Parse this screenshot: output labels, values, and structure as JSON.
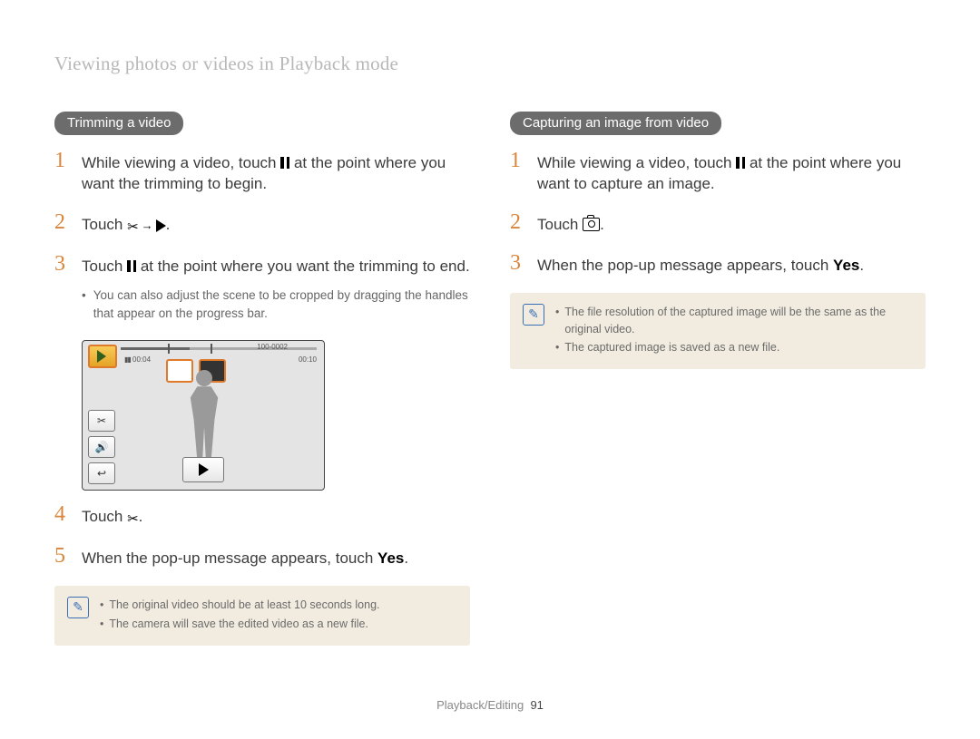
{
  "running_head": "Viewing photos or videos in Playback mode",
  "left": {
    "heading": "Trimming a video",
    "steps": [
      {
        "pre": "While viewing a video, touch ",
        "post": " at the point where you want the trimming to begin."
      },
      {
        "pre": "Touch "
      },
      {
        "pre": "Touch ",
        "post": " at the point where you want the trimming to end."
      },
      null,
      {
        "pre": "Touch "
      },
      {
        "pre": "When the pop-up message appears, touch ",
        "bold": "Yes",
        "post": "."
      }
    ],
    "step3_sub": "You can also adjust the scene to be cropped by dragging the handles that appear on the progress bar.",
    "notes": [
      "The original video should be at least 10 seconds long.",
      "The camera will save the edited video as a new file."
    ],
    "mock": {
      "time_elapsed": "00:04",
      "file_no": "100-0002",
      "time_total": "00:10"
    }
  },
  "right": {
    "heading": "Capturing an image from video",
    "steps": [
      {
        "pre": "While viewing a video, touch ",
        "post": " at the point where you want to capture an image."
      },
      {
        "pre": "Touch "
      },
      {
        "pre": "When the pop-up message appears, touch ",
        "bold": "Yes",
        "post": "."
      }
    ],
    "notes": [
      "The file resolution of the captured image will be the same as the original video.",
      "The captured image is saved as a new file."
    ]
  },
  "footer": {
    "section": "Playback/Editing",
    "page": "91"
  }
}
